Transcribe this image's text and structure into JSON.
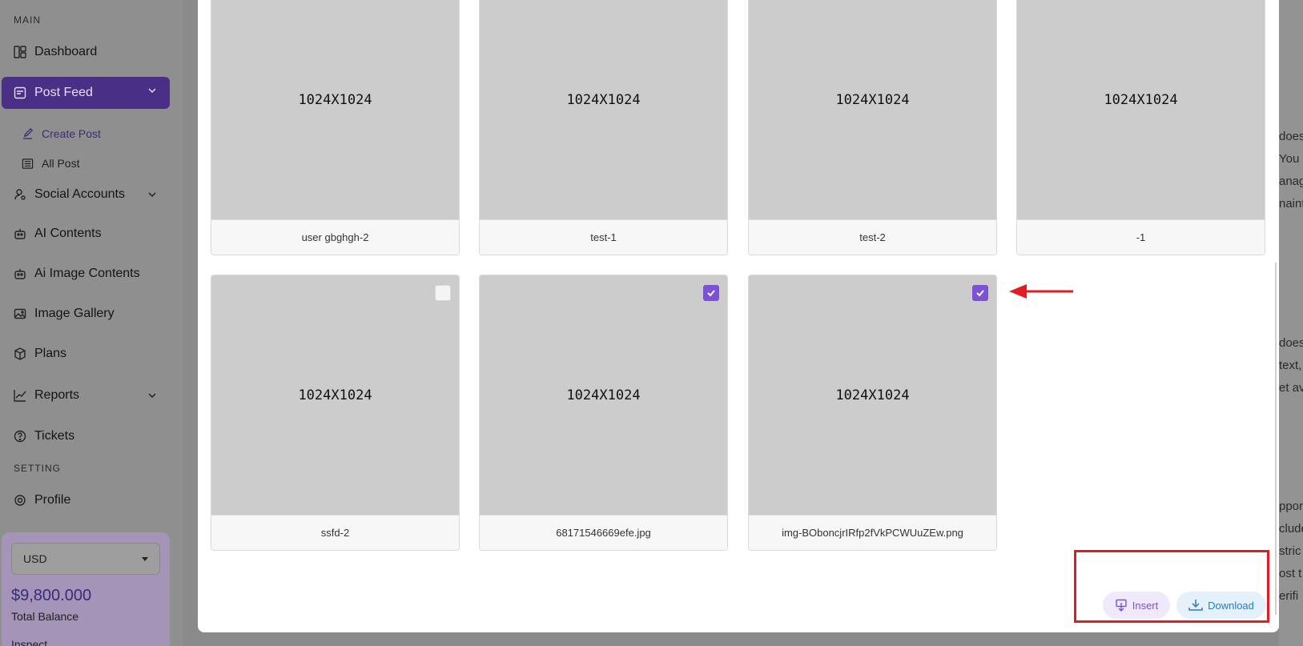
{
  "sidebar": {
    "section_main": "MAIN",
    "section_setting": "SETTING",
    "items": {
      "dashboard": "Dashboard",
      "post_feed": "Post Feed",
      "create_post": "Create Post",
      "all_post": "All Post",
      "social_accounts": "Social Accounts",
      "ai_contents": "AI Contents",
      "ai_image_contents": "Ai Image Contents",
      "image_gallery": "Image Gallery",
      "plans": "Plans",
      "reports": "Reports",
      "tickets": "Tickets",
      "profile": "Profile"
    },
    "balance": {
      "currency": "USD",
      "amount": "$9,800.000",
      "label": "Total Balance",
      "extra": "Inspect"
    }
  },
  "background_fragments": [
    "does",
    "You",
    "anag",
    "naint",
    "does",
    "text,",
    "et av",
    "pport",
    "clude",
    "stric",
    "ost t",
    "erifi"
  ],
  "gallery": {
    "images": [
      {
        "dims": "1024X1024",
        "name": "user gbghgh-2",
        "checked": false
      },
      {
        "dims": "1024X1024",
        "name": "test-1",
        "checked": false
      },
      {
        "dims": "1024X1024",
        "name": "test-2",
        "checked": false
      },
      {
        "dims": "1024X1024",
        "name": "-1",
        "checked": false
      },
      {
        "dims": "1024X1024",
        "name": "ssfd-2",
        "checked": false
      },
      {
        "dims": "1024X1024",
        "name": "68171546669efe.jpg",
        "checked": true
      },
      {
        "dims": "1024X1024",
        "name": "img-BOboncjrIRfp2fVkPCWUuZEw.png",
        "checked": true
      }
    ]
  },
  "actions": {
    "insert_label": "Insert",
    "download_label": "Download"
  },
  "colors": {
    "accent": "#7b52d3",
    "annotation": "#e31b23",
    "download": "#2a7bc0"
  }
}
